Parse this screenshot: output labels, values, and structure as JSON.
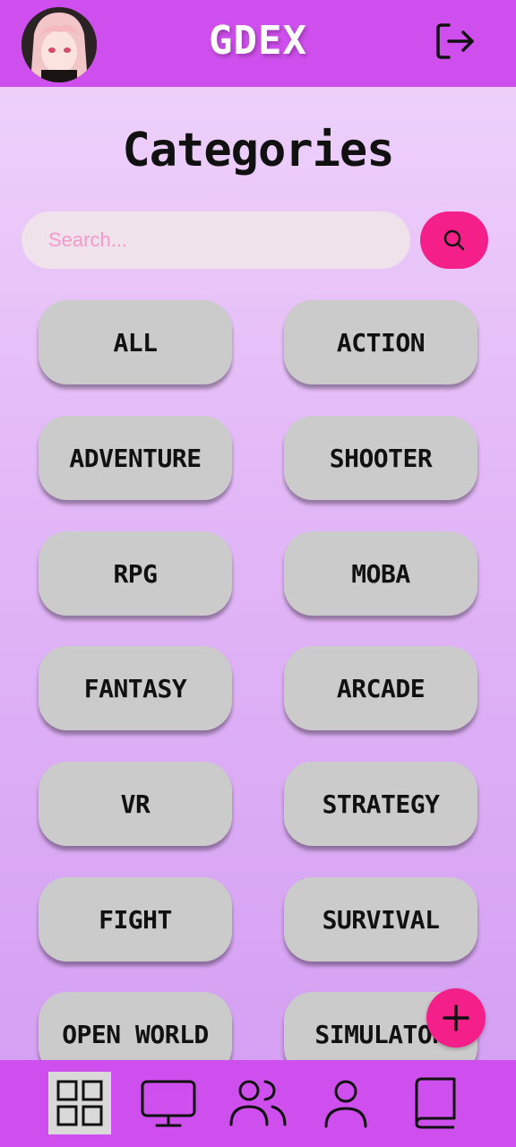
{
  "header": {
    "title": "GDEX",
    "avatar_icon": "user-avatar",
    "logout_icon": "logout-icon"
  },
  "main": {
    "title": "Categories",
    "search": {
      "placeholder": "Search...",
      "value": ""
    },
    "categories": [
      "ALL",
      "ACTION",
      "ADVENTURE",
      "SHOOTER",
      "RPG",
      "MOBA",
      "FANTASY",
      "ARCADE",
      "VR",
      "STRATEGY",
      "FIGHT",
      "SURVIVAL",
      "OPEN WORLD",
      "SIMULATOR"
    ]
  },
  "bottom_nav": {
    "items": [
      {
        "icon": "grid-icon",
        "active": true
      },
      {
        "icon": "monitor-icon",
        "active": false
      },
      {
        "icon": "users-icon",
        "active": false
      },
      {
        "icon": "profile-icon",
        "active": false
      },
      {
        "icon": "book-icon",
        "active": false
      }
    ]
  },
  "colors": {
    "bar": "#cf4fee",
    "accent": "#f51f8a",
    "chip": "#cbcbcb",
    "search_bg": "#f0e2ea"
  }
}
